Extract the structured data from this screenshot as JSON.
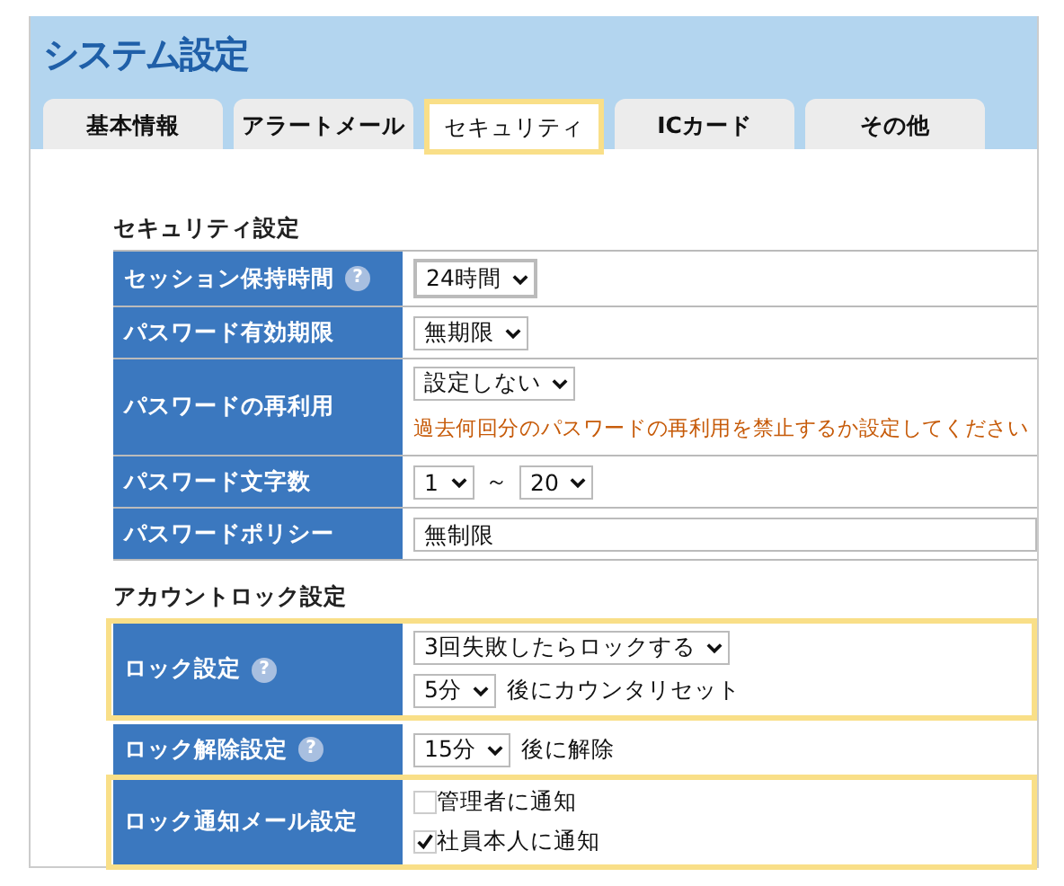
{
  "window": {
    "title": "システム設定"
  },
  "tabs": [
    {
      "label": "基本情報",
      "selected": false
    },
    {
      "label": "アラートメール",
      "selected": false
    },
    {
      "label": "セキュリティ",
      "selected": true
    },
    {
      "label": "ICカード",
      "selected": false
    },
    {
      "label": "その他",
      "selected": false
    }
  ],
  "sections": [
    {
      "heading": "セキュリティ設定",
      "rows": [
        {
          "label": "セッション保持時間",
          "help": "?",
          "highlighted": false,
          "lines": [
            [
              {
                "kind": "select",
                "value": "24時間",
                "focused": true
              }
            ]
          ]
        },
        {
          "label": "パスワード有効期限",
          "highlighted": false,
          "lines": [
            [
              {
                "kind": "select",
                "value": "無期限",
                "focused": false
              }
            ]
          ]
        },
        {
          "label": "パスワードの再利用",
          "highlighted": false,
          "lines": [
            [
              {
                "kind": "select",
                "value": "設定しない",
                "focused": false
              }
            ],
            [
              {
                "kind": "note",
                "text": "過去何回分のパスワードの再利用を禁止するか設定してください"
              }
            ]
          ]
        },
        {
          "label": "パスワード文字数",
          "highlighted": false,
          "lines": [
            [
              {
                "kind": "select",
                "value": "1",
                "focused": false
              },
              {
                "kind": "text",
                "text": "～"
              },
              {
                "kind": "select",
                "value": "20",
                "focused": false
              }
            ]
          ]
        },
        {
          "label": "パスワードポリシー",
          "highlighted": false,
          "lines": [
            [
              {
                "kind": "input",
                "value": "無制限"
              }
            ]
          ]
        }
      ]
    },
    {
      "heading": "アカウントロック設定",
      "rows": [
        {
          "label": "ロック設定",
          "help": "?",
          "highlighted": true,
          "lines": [
            [
              {
                "kind": "select",
                "value": "3回失敗したらロックする",
                "focused": false
              }
            ],
            [
              {
                "kind": "select",
                "value": "5分",
                "focused": false
              },
              {
                "kind": "text",
                "text": "後にカウンタリセット"
              }
            ]
          ]
        },
        {
          "label": "ロック解除設定",
          "help": "?",
          "highlighted": false,
          "lines": [
            [
              {
                "kind": "select",
                "value": "15分",
                "focused": false
              },
              {
                "kind": "text",
                "text": "後に解除"
              }
            ]
          ]
        },
        {
          "label": "ロック通知メール設定",
          "highlighted": true,
          "lines": [
            [
              {
                "kind": "checkbox",
                "label": "管理者に通知",
                "checked": false
              }
            ],
            [
              {
                "kind": "checkbox",
                "label": "社員本人に通知",
                "checked": true
              }
            ]
          ]
        }
      ]
    }
  ]
}
